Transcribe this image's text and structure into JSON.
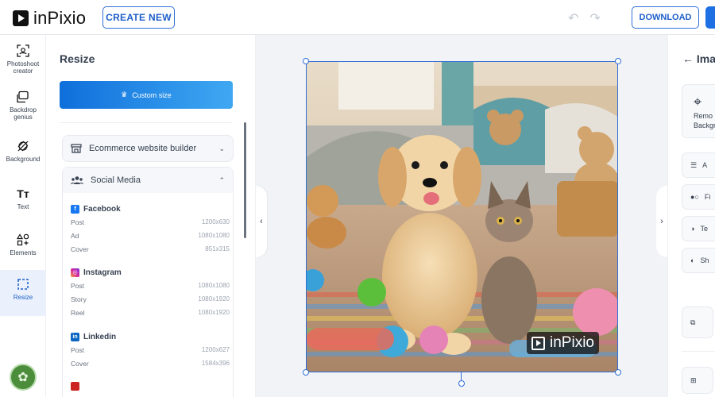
{
  "app": {
    "logo_text": "inPixio"
  },
  "topbar": {
    "create_new_label": "CREATE NEW",
    "download_label": "DOWNLOAD",
    "undo_icon": "undo-icon",
    "redo_icon": "redo-icon"
  },
  "rail": {
    "items": [
      {
        "label": "Photoshoot creator",
        "icon": "photoshoot-icon"
      },
      {
        "label": "Backdrop genius",
        "icon": "backdrop-icon"
      },
      {
        "label": "Background",
        "icon": "background-icon"
      },
      {
        "label": "Text",
        "icon": "text-icon"
      },
      {
        "label": "Elements",
        "icon": "elements-icon"
      },
      {
        "label": "Resize",
        "icon": "resize-icon",
        "active": true
      }
    ]
  },
  "resize_panel": {
    "title": "Resize",
    "custom_size_label": "Custom size",
    "ecommerce_label": "Ecommerce website builder",
    "social_label": "Social Media",
    "groups": [
      {
        "name": "Facebook",
        "color": "#1877f2",
        "rows": [
          {
            "label": "Post",
            "size": "1200x630"
          },
          {
            "label": "Ad",
            "size": "1080x1080"
          },
          {
            "label": "Cover",
            "size": "851x315"
          }
        ]
      },
      {
        "name": "Instagram",
        "color": "#d6249f",
        "rows": [
          {
            "label": "Post",
            "size": "1080x1080"
          },
          {
            "label": "Story",
            "size": "1080x1920"
          },
          {
            "label": "Reel",
            "size": "1080x1920"
          }
        ]
      },
      {
        "name": "Linkedin",
        "color": "#0a66c2",
        "rows": [
          {
            "label": "Post",
            "size": "1200x627"
          },
          {
            "label": "Cover",
            "size": "1584x396"
          }
        ]
      }
    ]
  },
  "canvas": {
    "watermark_text": "inPixio"
  },
  "right_panel": {
    "title": "Ima",
    "remove_bg_line1": "Remo",
    "remove_bg_line2": "Backgro",
    "tools": [
      {
        "label": "A",
        "icon": "adjust-icon"
      },
      {
        "label": "Fi",
        "icon": "filter-icon"
      },
      {
        "label": "Te",
        "icon": "tone-icon"
      },
      {
        "label": "Sh",
        "icon": "shadow-icon"
      }
    ]
  }
}
